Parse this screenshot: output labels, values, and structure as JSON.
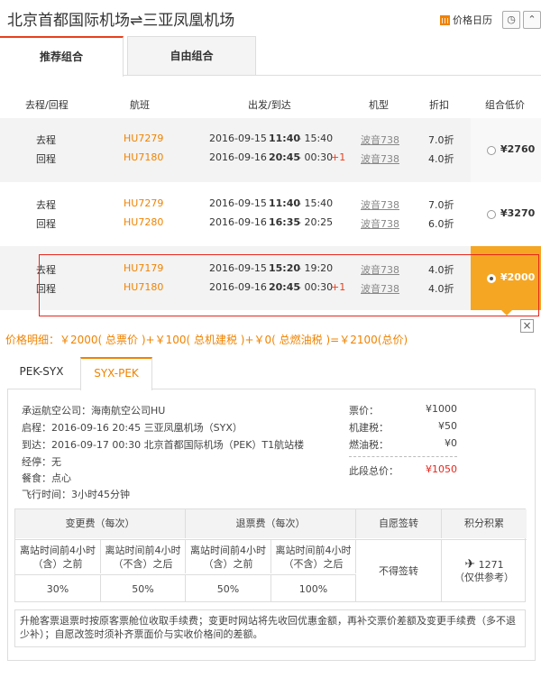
{
  "header": {
    "route": "北京首都国际机场⇌三亚凤凰机场",
    "calendar_label": "价格日历",
    "clock_icon": "clock-icon",
    "collapse_icon": "chevron-up-icon"
  },
  "tabs": [
    "推荐组合",
    "自由组合"
  ],
  "table_headers": [
    "去程/回程",
    "航班",
    "出发/到达",
    "机型",
    "折扣",
    "组合低价"
  ],
  "rows": [
    {
      "legs": [
        {
          "dir": "去程",
          "flight": "HU7279",
          "date": "2016-09-15",
          "dep": "11:40",
          "arr": "- 15:40",
          "plus": "",
          "plane": "波音738",
          "discount": "7.0折"
        },
        {
          "dir": "回程",
          "flight": "HU7180",
          "date": "2016-09-16",
          "dep": "20:45",
          "arr": "- 00:30",
          "plus": "+1",
          "plane": "波音738",
          "discount": "4.0折"
        }
      ],
      "price": "¥2760",
      "selected": false
    },
    {
      "legs": [
        {
          "dir": "去程",
          "flight": "HU7279",
          "date": "2016-09-15",
          "dep": "11:40",
          "arr": "- 15:40",
          "plus": "",
          "plane": "波音738",
          "discount": "7.0折"
        },
        {
          "dir": "回程",
          "flight": "HU7280",
          "date": "2016-09-16",
          "dep": "16:35",
          "arr": "- 20:25",
          "plus": "",
          "plane": "波音738",
          "discount": "6.0折"
        }
      ],
      "price": "¥3270",
      "selected": false
    },
    {
      "legs": [
        {
          "dir": "去程",
          "flight": "HU7179",
          "date": "2016-09-15",
          "dep": "15:20",
          "arr": "- 19:20",
          "plus": "",
          "plane": "波音738",
          "discount": "4.0折"
        },
        {
          "dir": "回程",
          "flight": "HU7180",
          "date": "2016-09-16",
          "dep": "20:45",
          "arr": "- 00:30",
          "plus": "+1",
          "plane": "波音738",
          "discount": "4.0折"
        }
      ],
      "price": "¥2000",
      "selected": true
    }
  ],
  "price_detail": "价格明细：￥2000( 总票价 )+￥100( 总机建税 )+￥0( 总燃油税 )=￥2100(总价)",
  "segment_tabs": [
    "PEK-SYX",
    "SYX-PEK"
  ],
  "segment": {
    "carrier": "承运航空公司：海南航空公司HU",
    "depart": "启程：2016-09-16 20:45 三亚凤凰机场（SYX）",
    "arrive": "到达：2016-09-17 00:30 北京首都国际机场（PEK）T1航站楼",
    "stops": "经停：无",
    "meal": "餐食：点心",
    "duration": "飞行时间：3小时45分钟",
    "fees": [
      {
        "label": "票价：",
        "value": "¥1000"
      },
      {
        "label": "机建税：",
        "value": "¥50"
      },
      {
        "label": "燃油税：",
        "value": "¥0"
      }
    ],
    "total_label": "此段总价：",
    "total_value": "¥1050"
  },
  "rules": {
    "change_header": "变更费（每次）",
    "refund_header": "退票费（每次）",
    "endorse_header": "自愿签转",
    "points_header": "积分积累",
    "sub_before": "离站时间前4小时\n（含）之前",
    "sub_after": "离站时间前4小时\n（不含）之后",
    "change_before": "30%",
    "change_after": "50%",
    "refund_before": "50%",
    "refund_after": "100%",
    "endorse_value": "不得签转",
    "points_value": "1271",
    "points_note": "（仅供参考）"
  },
  "note": "升舱客票退票时按原客票舱位收取手续费；变更时网站将先收回优惠金额，再补交票价差额及变更手续费（多不退少补）；自愿改签时须补齐票面价与实收价格间的差额。"
}
